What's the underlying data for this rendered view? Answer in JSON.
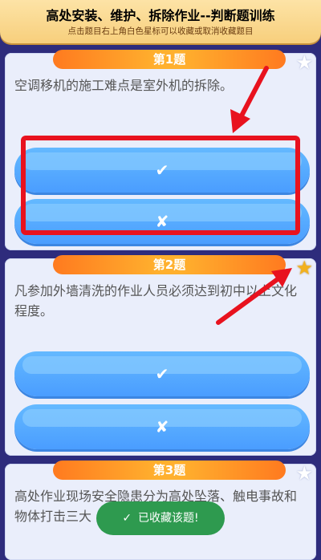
{
  "header": {
    "title": "高处安装、维护、拆除作业--判断题训练",
    "subtitle": "点击题目右上角白色星标可以收藏或取消收藏题目"
  },
  "questions": [
    {
      "number": "第1题",
      "text": "空调移机的施工难点是室外机的拆除。",
      "favorited": false,
      "true_label": "✔",
      "false_label": "✘"
    },
    {
      "number": "第2题",
      "text": "凡参加外墙清洗的作业人员必须达到初中以上文化程度。",
      "favorited": true,
      "true_label": "✔",
      "false_label": "✘"
    },
    {
      "number": "第3题",
      "text": "高处作业现场安全隐患分为高处坠落、触电事故和物体打击三大",
      "favorited": false
    }
  ],
  "toast": {
    "text": "已收藏该题!",
    "icon": "check-icon"
  },
  "icons": {
    "star": "star-icon"
  },
  "colors": {
    "highlight": "#e8121e",
    "option": "#4a9dff",
    "title_bar": "#ffb02e",
    "favorite_star": "#f3b11c",
    "toast": "#2e9a4f"
  }
}
